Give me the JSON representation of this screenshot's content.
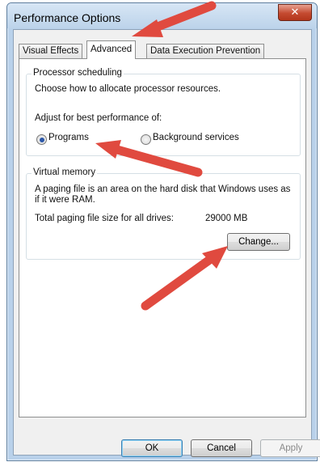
{
  "window": {
    "title": "Performance Options",
    "close_glyph": "✕"
  },
  "tabs": [
    {
      "label": "Visual Effects"
    },
    {
      "label": "Advanced"
    },
    {
      "label": "Data Execution Prevention"
    }
  ],
  "processor_scheduling": {
    "group_label": "Processor scheduling",
    "description": "Choose how to allocate processor resources.",
    "adjust_label": "Adjust for best performance of:",
    "options": [
      {
        "label": "Programs",
        "checked": true
      },
      {
        "label": "Background services",
        "checked": false
      }
    ]
  },
  "virtual_memory": {
    "group_label": "Virtual memory",
    "description_line1": "A paging file is an area on the hard disk that Windows uses as",
    "description_line2": "if it were RAM.",
    "total_label": "Total paging file size for all drives:",
    "total_value": "29000 MB",
    "change_button": "Change..."
  },
  "footer": {
    "ok": "OK",
    "cancel": "Cancel",
    "apply": "Apply"
  },
  "annotation": {
    "arrow_color": "#e04a3f"
  }
}
